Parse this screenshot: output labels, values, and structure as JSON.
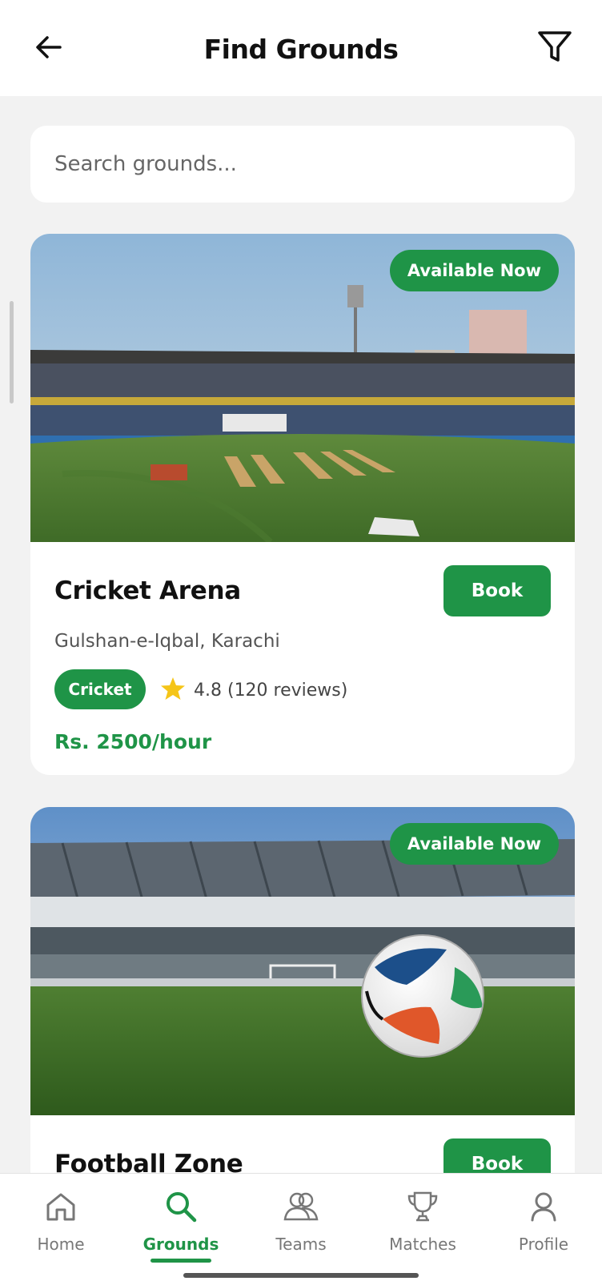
{
  "header": {
    "title": "Find Grounds"
  },
  "search": {
    "placeholder": "Search grounds..."
  },
  "grounds": [
    {
      "badge": "Available Now",
      "name": "Cricket Arena",
      "location": "Gulshan-e-Iqbal, Karachi",
      "sport": "Cricket",
      "rating": "4.8 (120 reviews)",
      "price": "Rs. 2500/hour",
      "book_label": "Book"
    },
    {
      "badge": "Available Now",
      "name": "Football Zone",
      "book_label": "Book"
    }
  ],
  "bottom_nav": {
    "items": [
      {
        "label": "Home",
        "icon": "home-icon"
      },
      {
        "label": "Grounds",
        "icon": "search-icon",
        "active": true
      },
      {
        "label": "Teams",
        "icon": "people-icon"
      },
      {
        "label": "Matches",
        "icon": "trophy-icon"
      },
      {
        "label": "Profile",
        "icon": "person-icon"
      }
    ]
  },
  "colors": {
    "accent": "#1f9447",
    "background": "#f2f2f2",
    "star": "#f5c518"
  }
}
